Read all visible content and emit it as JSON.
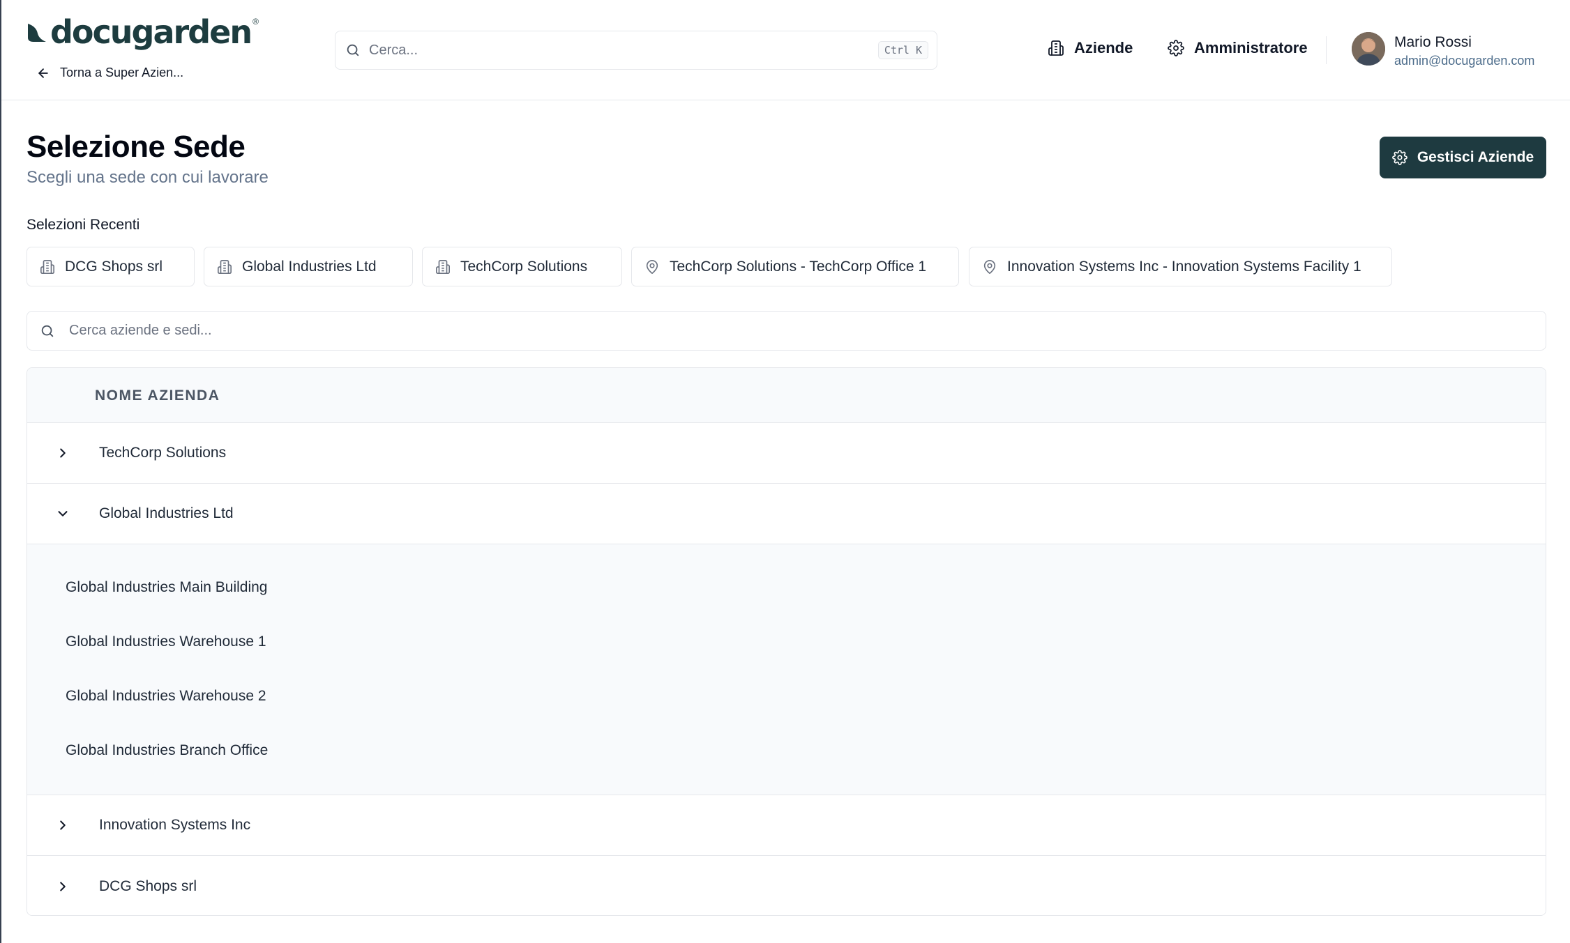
{
  "header": {
    "logo_text": "docugarden",
    "logo_reg": "®",
    "back_label": "Torna a Super Azien...",
    "search_placeholder": "Cerca...",
    "search_shortcut": "Ctrl K",
    "nav": [
      {
        "label": "Aziende",
        "icon": "building-icon"
      },
      {
        "label": "Amministratore",
        "icon": "gear-icon"
      }
    ],
    "user": {
      "name": "Mario Rossi",
      "email": "admin@docugarden.com"
    }
  },
  "page": {
    "title": "Selezione Sede",
    "subtitle": "Scegli una sede con cui lavorare",
    "manage_button": "Gestisci Aziende",
    "recent_label": "Selezioni Recenti",
    "recent": [
      {
        "label": "DCG Shops srl",
        "icon": "building-icon"
      },
      {
        "label": "Global Industries Ltd",
        "icon": "building-icon"
      },
      {
        "label": "TechCorp Solutions",
        "icon": "building-icon"
      },
      {
        "label": "TechCorp Solutions - TechCorp Office 1",
        "icon": "map-pin-icon"
      },
      {
        "label": "Innovation Systems Inc - Innovation Systems Facility 1",
        "icon": "map-pin-icon"
      }
    ],
    "filter_placeholder": "Cerca aziende e sedi..."
  },
  "table": {
    "column_header": "NOME AZIENDA",
    "rows": [
      {
        "name": "TechCorp Solutions",
        "expanded": false
      },
      {
        "name": "Global Industries Ltd",
        "expanded": true
      },
      {
        "name": "Innovation Systems Inc",
        "expanded": false
      },
      {
        "name": "DCG Shops srl",
        "expanded": false
      }
    ],
    "sites": [
      "Global Industries Main Building",
      "Global Industries Warehouse 1",
      "Global Industries Warehouse 2",
      "Global Industries Branch Office"
    ]
  },
  "colors": {
    "brand": "#1d3c3f",
    "button_bg": "#1e3a40",
    "border": "#e5e7eb",
    "panel_bg": "#f8fafc"
  }
}
